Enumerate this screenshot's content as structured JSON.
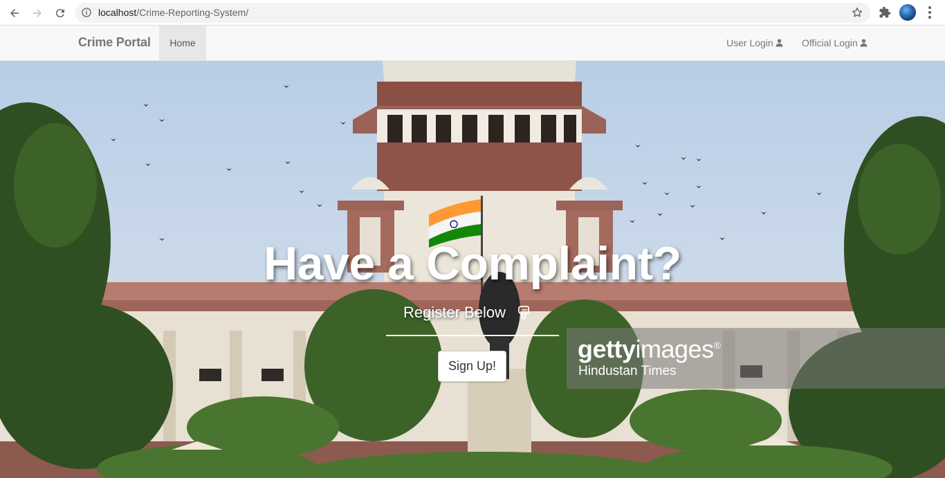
{
  "browser": {
    "url_host": "localhost",
    "url_path": "/Crime-Reporting-System/",
    "icons": [
      "back-arrow-icon",
      "forward-arrow-icon",
      "reload-icon",
      "info-icon",
      "star-icon",
      "puzzle-icon",
      "profile-avatar",
      "kebab-menu-icon"
    ]
  },
  "navbar": {
    "brand": "Crime Portal",
    "home": "Home",
    "user_login": "User Login",
    "official_login": "Official Login",
    "login_icon": "user-icon"
  },
  "hero": {
    "headline": "Have a Complaint?",
    "subline": "Register Below",
    "subline_icon": "hand-pointing-down-icon",
    "signup_button": "Sign Up!",
    "watermark": {
      "brand_bold": "getty",
      "brand_light": "images",
      "registered": "®",
      "credit": "Hindustan Times"
    }
  }
}
